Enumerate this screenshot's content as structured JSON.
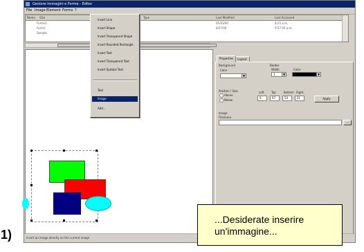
{
  "window": {
    "title": "Gestore Immagini e Forme - Editor",
    "menus": [
      "File",
      "Image",
      "Element",
      "Forms",
      "?"
    ]
  },
  "list": {
    "columns": [
      "Name",
      "Size",
      "Type",
      "Last Modified",
      "Last Accessed"
    ],
    "rows": [
      {
        "name": "Forms1",
        "date": "05/03/00",
        "time": "8:25 a.m."
      },
      {
        "name": "Form2",
        "date": "6/27/00",
        "time": "9:57:45 a.m."
      },
      {
        "name": "Sample"
      }
    ]
  },
  "menu": {
    "items": [
      "Insert Line",
      "Insert Shape",
      "Insert Transparent Shape",
      "Insert Rounded Rectangle",
      "Insert Text",
      "Insert Transparent Text",
      "Insert Symbol Text",
      "Text",
      "Image",
      "Add..."
    ],
    "selected_index": 8
  },
  "properties": {
    "tabs": [
      "Properties",
      "Layout"
    ],
    "background_label": "Background",
    "color_label": "Color",
    "border_label": "Border",
    "width_label": "Width",
    "border_color_label": "Color",
    "width_value": "1",
    "border_color_hex": "#000000",
    "position_label": "Position / Size",
    "radio_options": [
      "Above",
      "Below"
    ],
    "coord_labels": [
      "Left",
      "Top",
      "Bottom",
      "Right"
    ],
    "coord_values": [
      "9",
      "67",
      "54",
      "21"
    ],
    "apply_label": "Apply",
    "image_label": "Image",
    "image_sublabel": "Filename",
    "browse_label": "..."
  },
  "status": {
    "text": "Insert an image directly on the current image"
  },
  "canvas": {
    "shapes": [
      {
        "name": "green-rectangle",
        "color": "#00ff00"
      },
      {
        "name": "red-rectangle",
        "color": "#ff0000"
      },
      {
        "name": "navy-rectangle",
        "color": "#000080"
      },
      {
        "name": "cyan-ellipse",
        "color": "#00ffff"
      }
    ]
  },
  "annotation": {
    "step_label": "1)",
    "callout_lines": [
      "...Desiderate inserire",
      "un'immagine..."
    ]
  }
}
